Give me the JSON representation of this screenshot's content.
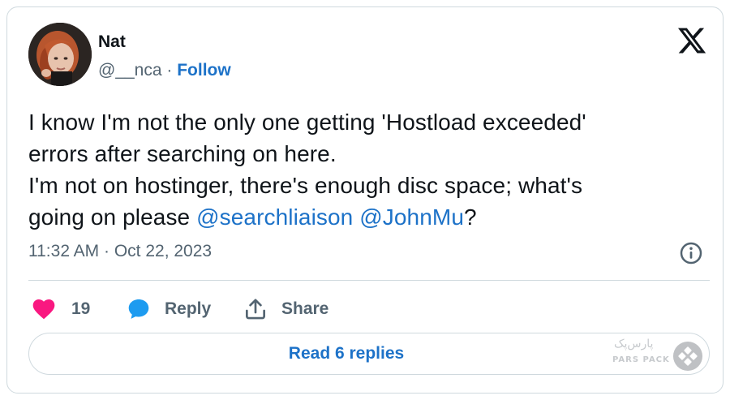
{
  "author": {
    "name": "Nat",
    "handle": "@__nca",
    "separator": " · ",
    "follow_label": "Follow"
  },
  "tweet": {
    "line1": "I know I'm not the only one getting 'Hostload exceeded'",
    "line2": "errors after searching on here.",
    "line3": "I'm not on hostinger, there's enough disc space; what's",
    "line4_prefix": "going on please ",
    "mention1": "@searchliaison",
    "mention_sep": " ",
    "mention2": "@JohnMu",
    "line4_suffix": "?"
  },
  "timestamp": "11:32 AM · Oct 22, 2023",
  "actions": {
    "like_count": "19",
    "reply_label": "Reply",
    "share_label": "Share"
  },
  "read_replies_label": "Read 6 replies",
  "watermark": {
    "fa_text": "پارس‌پک",
    "en_text": "PARS PACK"
  },
  "colors": {
    "accent_blue": "#1d72c8",
    "like_pink": "#f91880",
    "reply_blue": "#1d9bf0",
    "muted_text": "#536471",
    "border": "#cfd9de"
  },
  "icons": {
    "brand": "x-logo-icon",
    "info": "info-icon",
    "like": "heart-icon",
    "reply": "speech-bubble-icon",
    "share": "share-icon"
  }
}
